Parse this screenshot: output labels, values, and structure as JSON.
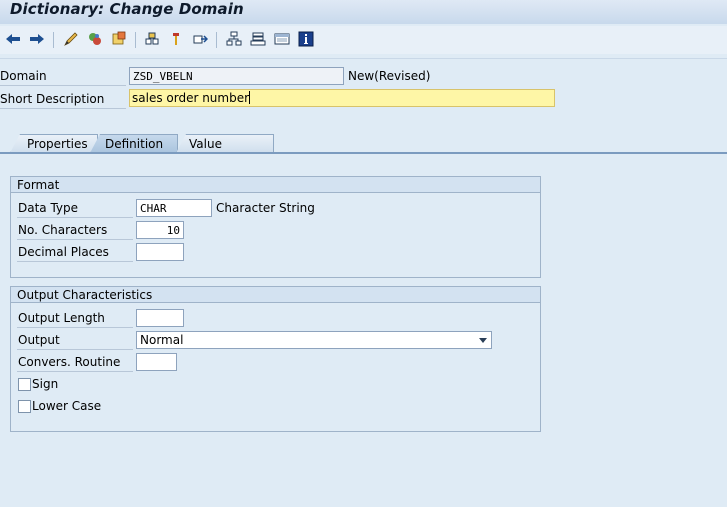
{
  "window": {
    "title": "Dictionary: Change Domain"
  },
  "toolbar": {
    "icons": [
      "back-arrow-icon",
      "forward-arrow-icon",
      "edit-toggle-icon",
      "other-object-icon",
      "activate-icon",
      "where-used-icon",
      "display-object-list-icon",
      "navigate-icon",
      "hierarchy-icon",
      "object-list-icon",
      "layout-icon",
      "info-icon"
    ]
  },
  "header": {
    "domain_label": "Domain",
    "domain_value": "ZSD_VBELN",
    "domain_status": "New(Revised)",
    "short_desc_label": "Short Description",
    "short_desc_value": "sales order number"
  },
  "tabs": [
    {
      "label": "Properties",
      "active": false
    },
    {
      "label": "Definition",
      "active": true
    },
    {
      "label": "Value Range",
      "active": false
    }
  ],
  "format": {
    "title": "Format",
    "data_type_label": "Data Type",
    "data_type_value": "CHAR",
    "data_type_desc": "Character String",
    "no_chars_label": "No. Characters",
    "no_chars_value": "10",
    "decimal_label": "Decimal Places",
    "decimal_value": ""
  },
  "output": {
    "title": "Output Characteristics",
    "output_length_label": "Output Length",
    "output_length_value": "",
    "output_label": "Output",
    "output_value": "Normal",
    "convers_label": "Convers. Routine",
    "convers_value": "",
    "sign_label": "Sign",
    "sign_checked": false,
    "lower_case_label": "Lower Case",
    "lower_case_checked": false
  },
  "colors": {
    "background": "#dfebf5",
    "highlight_field": "#fef6a6",
    "tab_border": "#7b9bbf"
  }
}
